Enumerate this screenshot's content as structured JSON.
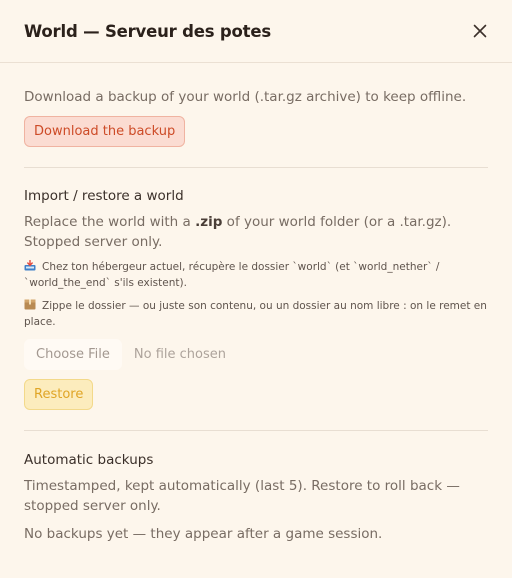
{
  "modal": {
    "title": "World — Serveur des potes",
    "close_label": "×"
  },
  "download": {
    "description": "Download a backup of your world (.tar.gz archive) to keep offline.",
    "button_label": "Download the backup"
  },
  "import": {
    "heading": "Import / restore a world",
    "desc_before": "Replace the world with a ",
    "desc_bold": ".zip",
    "desc_after": " of your world folder (or a .tar.gz). Stopped server only.",
    "step1_text": "Chez ton hébergeur actuel, récupère le dossier `world` (et `world_nether` / `world_the_end` s'ils existent).",
    "step2_text": "Zippe le dossier — ou juste son contenu, ou un dossier au nom libre : on le remet en place.",
    "file_button_label": "Choose File",
    "file_status": "No file chosen",
    "restore_label": "Restore"
  },
  "auto": {
    "heading": "Automatic backups",
    "description": "Timestamped, kept automatically (last 5). Restore to roll back — stopped server only.",
    "empty_text": "No backups yet — they appear after a game session."
  },
  "icons": {
    "close": "close-icon",
    "step1": "inbox-tray-icon",
    "step2": "package-icon"
  },
  "colors": {
    "background": "#fdf6ec",
    "download_accent": "#cd4b27",
    "restore_accent": "#e0a526"
  }
}
